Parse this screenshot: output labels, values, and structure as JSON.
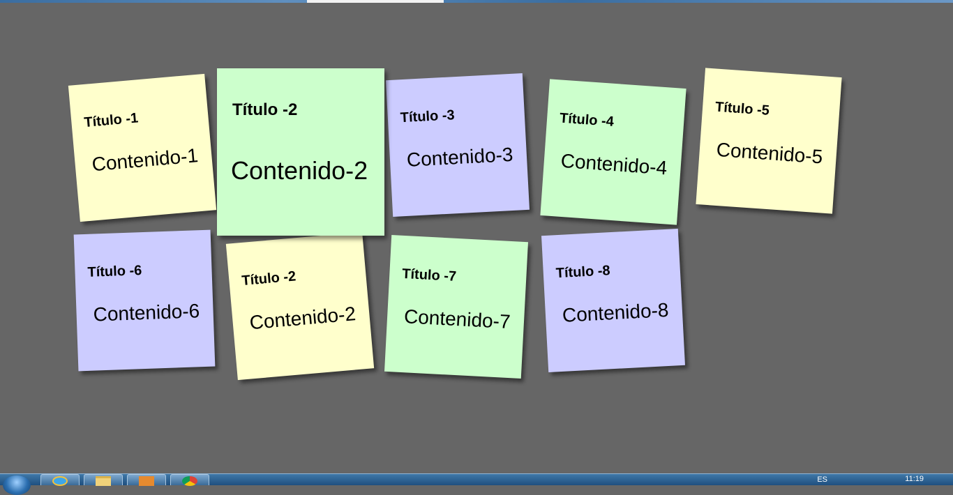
{
  "notes": [
    {
      "title": "Título -1",
      "content": "Contenido-1",
      "color": "#ffffcc"
    },
    {
      "title": "Título -2",
      "content": "Contenido-2",
      "color": "#ccffcc"
    },
    {
      "title": "Título -3",
      "content": "Contenido-3",
      "color": "#ccccff"
    },
    {
      "title": "Título -4",
      "content": "Contenido-4",
      "color": "#ccffcc"
    },
    {
      "title": "Título -5",
      "content": "Contenido-5",
      "color": "#ffffcc"
    },
    {
      "title": "Título -6",
      "content": "Contenido-6",
      "color": "#ccccff"
    },
    {
      "title": "Título -2",
      "content": "Contenido-2",
      "color": "#ffffcc"
    },
    {
      "title": "Título -7",
      "content": "Contenido-7",
      "color": "#ccffcc"
    },
    {
      "title": "Título -8",
      "content": "Contenido-8",
      "color": "#ccccff"
    }
  ],
  "taskbar": {
    "start_icon": "windows-start-orb",
    "apps": [
      {
        "icon": "internet-explorer-icon"
      },
      {
        "icon": "file-explorer-icon"
      },
      {
        "icon": "media-player-icon"
      },
      {
        "icon": "chrome-icon"
      }
    ],
    "language": "ES",
    "clock": "11:19"
  },
  "colors": {
    "board": "#666666",
    "yellow": "#ffffcc",
    "green": "#ccffcc",
    "blue": "#ccccff"
  }
}
